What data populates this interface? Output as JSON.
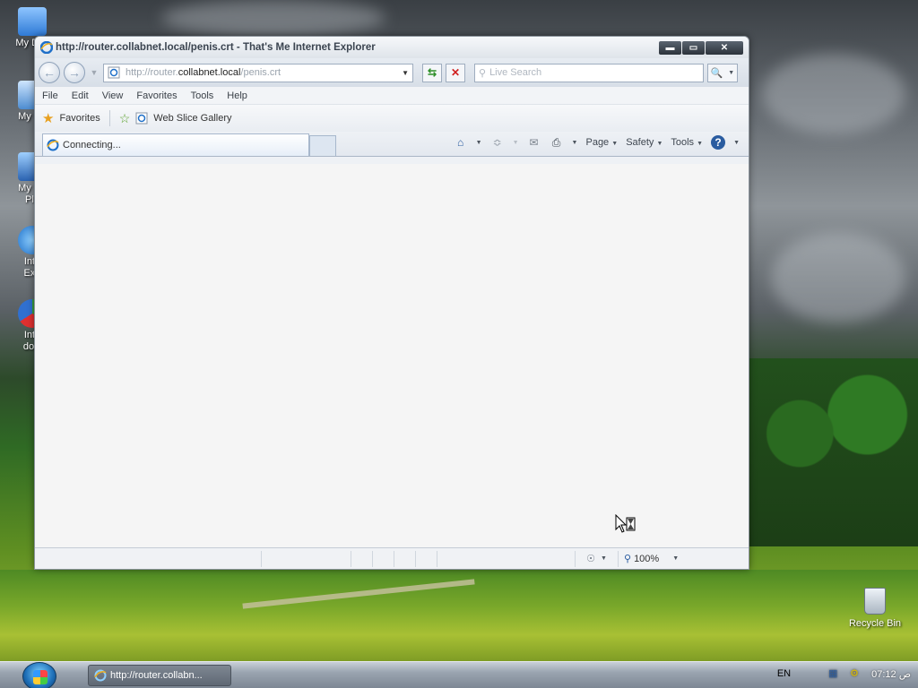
{
  "desktop": {
    "icons": [
      {
        "label": "My Doc"
      },
      {
        "label": "My Co"
      },
      {
        "label": "My Ne\nPla"
      },
      {
        "label": "Inte\nExp"
      },
      {
        "label": "Inte\ndow"
      }
    ],
    "recycle_bin": "Recycle Bin"
  },
  "window": {
    "title": "http://router.collabnet.local/penis.crt - That's Me Internet Explorer",
    "controls": {
      "minimize": "▬",
      "maximize": "▭",
      "close": "✕"
    },
    "address": {
      "url_prefix": "http://router.",
      "url_domain": "collabnet.local",
      "url_path": "/penis.crt"
    },
    "search": {
      "placeholder": "Live Search"
    },
    "menu": [
      "File",
      "Edit",
      "View",
      "Favorites",
      "Tools",
      "Help"
    ],
    "favorites_bar": {
      "favorites_label": "Favorites",
      "web_slice_label": "Web Slice Gallery"
    },
    "tab": {
      "label": "Connecting..."
    },
    "command_bar": {
      "page_label": "Page",
      "safety_label": "Safety",
      "tools_label": "Tools"
    },
    "status": {
      "zoom": "100%"
    }
  },
  "taskbar": {
    "task_label": "http://router.collabn...",
    "language": "EN",
    "clock": "07:12 ص"
  },
  "colors": {
    "window_bg": "#eef1f5",
    "content_bg": "#f5f5f5",
    "accent": "#2a5ca0"
  }
}
